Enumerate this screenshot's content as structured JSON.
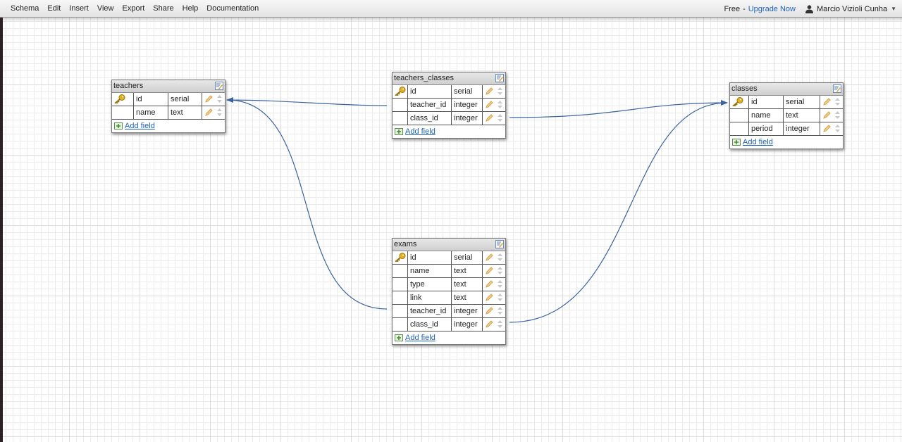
{
  "menubar": {
    "items": [
      "Schema",
      "Edit",
      "Insert",
      "View",
      "Export",
      "Share",
      "Help",
      "Documentation"
    ],
    "plan": "Free",
    "separator": "-",
    "upgrade": "Upgrade Now",
    "user": "Marcio Vizioli Cunha",
    "user_icon": "user-icon",
    "caret_icon": "caret-down-icon"
  },
  "colors": {
    "link_line": "#3a63a0",
    "link_text": "#1f63b8",
    "key_icon": "#e3b21c"
  },
  "add_field_label": "Add field",
  "tables": {
    "teachers": {
      "title": "teachers",
      "fields": [
        {
          "pk": true,
          "name": "id",
          "type": "serial"
        },
        {
          "pk": false,
          "name": "name",
          "type": "text"
        }
      ]
    },
    "teachers_classes": {
      "title": "teachers_classes",
      "fields": [
        {
          "pk": true,
          "name": "id",
          "type": "serial"
        },
        {
          "pk": false,
          "name": "teacher_id",
          "type": "integer"
        },
        {
          "pk": false,
          "name": "class_id",
          "type": "integer"
        }
      ]
    },
    "classes": {
      "title": "classes",
      "fields": [
        {
          "pk": true,
          "name": "id",
          "type": "serial"
        },
        {
          "pk": false,
          "name": "name",
          "type": "text"
        },
        {
          "pk": false,
          "name": "period",
          "type": "integer"
        }
      ]
    },
    "exams": {
      "title": "exams",
      "fields": [
        {
          "pk": true,
          "name": "id",
          "type": "serial"
        },
        {
          "pk": false,
          "name": "name",
          "type": "text"
        },
        {
          "pk": false,
          "name": "type",
          "type": "text"
        },
        {
          "pk": false,
          "name": "link",
          "type": "text"
        },
        {
          "pk": false,
          "name": "teacher_id",
          "type": "integer"
        },
        {
          "pk": false,
          "name": "class_id",
          "type": "integer"
        }
      ]
    }
  },
  "relations": [
    {
      "from": "teachers_classes.teacher_id",
      "to": "teachers.id"
    },
    {
      "from": "teachers_classes.class_id",
      "to": "classes.id"
    },
    {
      "from": "exams.teacher_id",
      "to": "teachers.id"
    },
    {
      "from": "exams.class_id",
      "to": "classes.id"
    }
  ]
}
